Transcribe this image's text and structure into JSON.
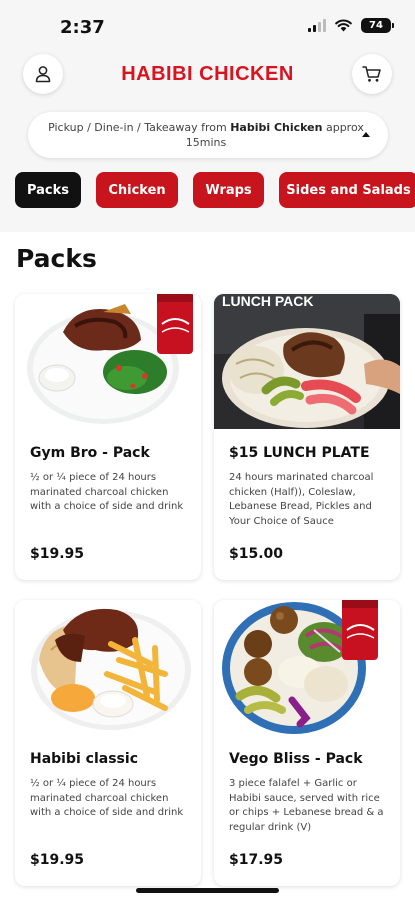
{
  "status_bar": {
    "time": "2:37",
    "battery": "74"
  },
  "header": {
    "logo_text": "HABIBI CHICKEN"
  },
  "pickup": {
    "prefix": "Pickup / Dine-in / Takeaway from ",
    "store": "Habibi Chicken",
    "suffix": " approx 15mins"
  },
  "tabs": [
    {
      "label": "Packs"
    },
    {
      "label": "Chicken"
    },
    {
      "label": "Wraps"
    },
    {
      "label": "Sides and Salads"
    }
  ],
  "section": {
    "title": "Packs"
  },
  "products": [
    {
      "name": "Gym Bro - Pack",
      "description": "½ or ¼ piece of 24 hours marinated charcoal chicken with a choice of side and drink",
      "price": "$19.95"
    },
    {
      "name": "$15 LUNCH PLATE",
      "description": "24 hours marinated charcoal chicken (Half)), Coleslaw, Lebanese Bread, Pickles and Your Choice of Sauce",
      "price": "$15.00",
      "image_text": "LUNCH PACK"
    },
    {
      "name": "Habibi classic",
      "description": "½ or ¼ piece of 24 hours marinated charcoal chicken with a choice of side and drink",
      "price": "$19.95"
    },
    {
      "name": "Vego Bliss - Pack",
      "description": "3 piece falafel + Garlic or Habibi sauce, served with rice or chips + Lebanese bread & a regular drink (V)",
      "price": "$17.95"
    }
  ],
  "colors": {
    "brand_red": "#d7141f",
    "tab_red": "#c8141c",
    "active_tab": "#111111"
  },
  "icons": [
    "person-icon",
    "cart-icon",
    "caret-up-icon",
    "wifi-icon",
    "signal-icon"
  ]
}
